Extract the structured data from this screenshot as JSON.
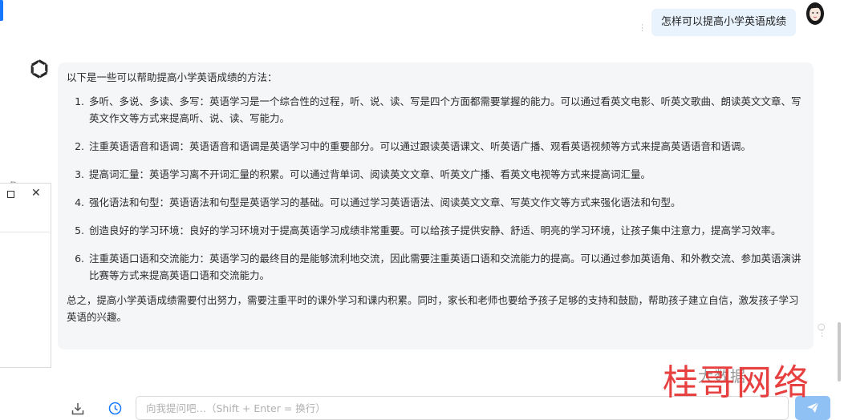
{
  "user_message": "怎样可以提高小学英语成绩",
  "assistant_message": {
    "intro": "以下是一些可以帮助提高小学英语成绩的方法：",
    "items": [
      "多听、多说、多读、多写：英语学习是一个综合性的过程，听、说、读、写是四个方面都需要掌握的能力。可以通过看英文电影、听英文歌曲、朗读英文文章、写英文作文等方式来提高听、说、读、写能力。",
      "注重英语语音和语调：英语语音和语调是英语学习中的重要部分。可以通过跟读英语课文、听英语广播、观看英语视频等方式来提高英语语音和语调。",
      "提高词汇量：英语学习离不开词汇量的积累。可以通过背单词、阅读英文文章、听英文广播、看英文电视等方式来提高词汇量。",
      "强化语法和句型：英语语法和句型是英语学习的基础。可以通过学习英语语法、阅读英文文章、写英文作文等方式来强化语法和句型。",
      "创造良好的学习环境：良好的学习环境对于提高英语学习成绩非常重要。可以给孩子提供安静、舒适、明亮的学习环境，让孩子集中注意力，提高学习效率。",
      "注重英语口语和交流能力：英语学习的最终目的是能够流利地交流，因此需要注重英语口语和交流能力的提高。可以通过参加英语角、和外教交流、参加英语演讲比赛等方式来提高英语口语和交流能力。"
    ],
    "summary": "总之，提高小学英语成绩需要付出努力，需要注重平时的课外学习和课内积累。同时，家长和老师也要给予孩子足够的支持和鼓励，帮助孩子建立自信，激发孩子学习英语的兴趣。"
  },
  "input": {
    "placeholder": "向我提问吧…（Shift + Enter = 换行）",
    "value": ""
  },
  "side_panel": {
    "maximize_icon": "maximize-icon",
    "close_label": "✕"
  },
  "watermark": {
    "main": "桂哥网络",
    "small": "大数据"
  },
  "colors": {
    "user_bubble": "#e8f3fd",
    "bot_bubble": "#f4f6f8",
    "send_button": "#8fc1f5",
    "watermark": "#e63030",
    "accent": "#1677ff"
  }
}
